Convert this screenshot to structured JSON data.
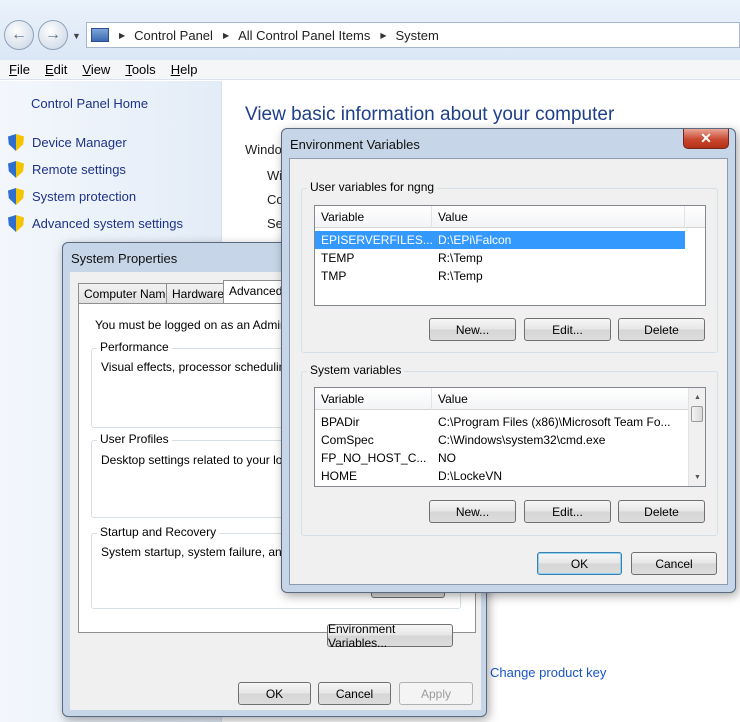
{
  "explorer": {
    "breadcrumbs": [
      "Control Panel",
      "All Control Panel Items",
      "System"
    ],
    "menu": [
      {
        "label": "File",
        "key": "F",
        "rest": "ile"
      },
      {
        "label": "Edit",
        "key": "E",
        "rest": "dit"
      },
      {
        "label": "View",
        "key": "V",
        "rest": "iew"
      },
      {
        "label": "Tools",
        "key": "T",
        "rest": "ools"
      },
      {
        "label": "Help",
        "key": "H",
        "rest": "elp"
      }
    ],
    "left_pane": {
      "home": "Control Panel Home",
      "tasks": [
        "Device Manager",
        "Remote settings",
        "System protection",
        "Advanced system settings"
      ]
    },
    "main": {
      "heading": "View basic information about your computer",
      "fragments": [
        "Windo",
        "Wi",
        "Co",
        "Se"
      ],
      "change_product_key": "Change product key"
    }
  },
  "system_properties": {
    "title": "System Properties",
    "tabs": [
      "Computer Name",
      "Hardware",
      "Advanced"
    ],
    "admin_note": "You must be logged on as an Administra",
    "groups": [
      {
        "label": "Performance",
        "text": "Visual effects, processor scheduling, m"
      },
      {
        "label": "User Profiles",
        "text": "Desktop settings related to your logon"
      },
      {
        "label": "Startup and Recovery",
        "text": "System startup, system failure, and deb"
      }
    ],
    "env_button": "Environment Variables...",
    "ok": "OK",
    "cancel": "Cancel",
    "apply": "Apply"
  },
  "env_vars": {
    "title": "Environment Variables",
    "close": "✕",
    "user_group_label": "User variables for ngng",
    "system_group_label": "System variables",
    "columns": [
      "Variable",
      "Value"
    ],
    "user_vars": [
      {
        "variable": "EPISERVERFILES...",
        "value": "D:\\EPi\\Falcon",
        "selected": true
      },
      {
        "variable": "TEMP",
        "value": "R:\\Temp",
        "selected": false
      },
      {
        "variable": "TMP",
        "value": "R:\\Temp",
        "selected": false
      }
    ],
    "system_vars": [
      {
        "variable": "BPADir",
        "value": "C:\\Program Files (x86)\\Microsoft Team Fo..."
      },
      {
        "variable": "ComSpec",
        "value": "C:\\Windows\\system32\\cmd.exe"
      },
      {
        "variable": "FP_NO_HOST_C...",
        "value": "NO"
      },
      {
        "variable": "HOME",
        "value": "D:\\LockeVN"
      }
    ],
    "user_buttons": {
      "new": "New...",
      "edit": "Edit...",
      "delete": "Delete"
    },
    "system_buttons": {
      "new": "New...",
      "edit": "Edit...",
      "delete": "Delete"
    },
    "ok": "OK",
    "cancel": "Cancel"
  }
}
